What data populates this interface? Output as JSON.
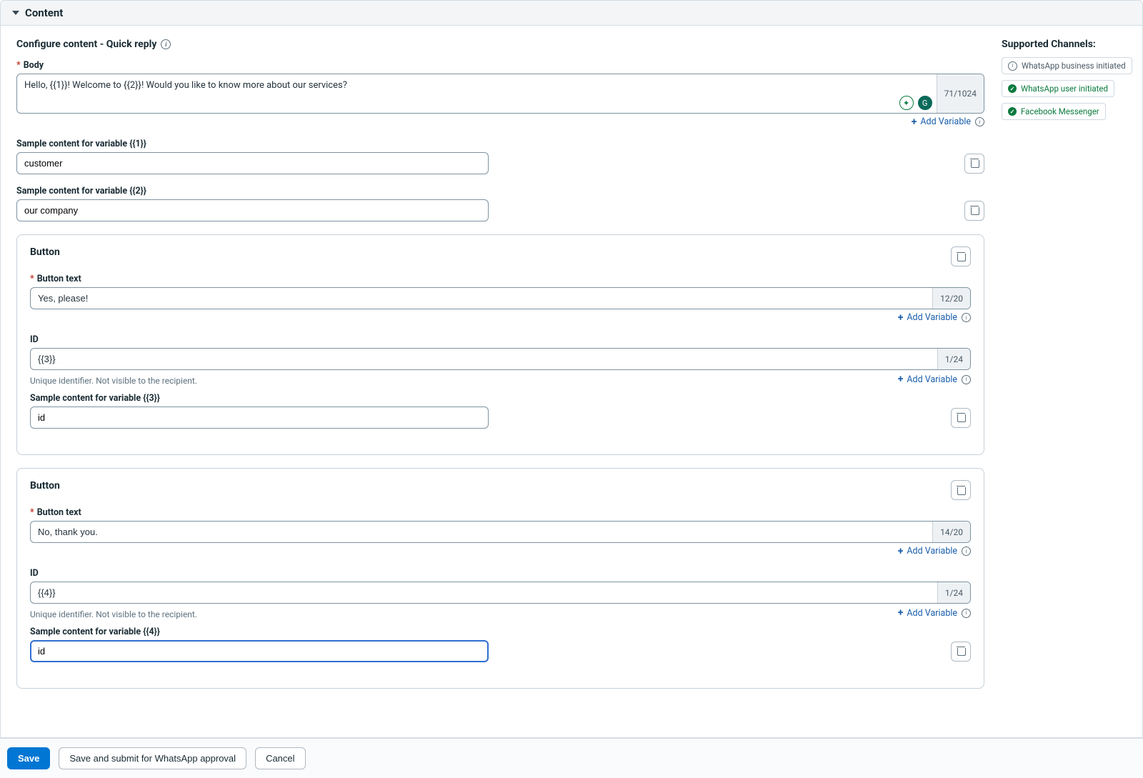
{
  "section": {
    "title": "Content"
  },
  "subheader": "Configure content - Quick reply",
  "body": {
    "label": "Body",
    "value": "Hello, {{1}}! Welcome to {{2}}! Would you like to know more about our services?",
    "counter": "71/1024",
    "addVariable": "Add Variable"
  },
  "vars": [
    {
      "label": "Sample content for variable {{1}}",
      "value": "customer"
    },
    {
      "label": "Sample content for variable {{2}}",
      "value": "our company"
    }
  ],
  "buttons": [
    {
      "title": "Button",
      "textLabel": "Button text",
      "textValue": "Yes, please!",
      "textCounter": "12/20",
      "addVariable": "Add Variable",
      "idLabel": "ID",
      "idValue": "{{3}}",
      "idCounter": "1/24",
      "idHint": "Unique identifier. Not visible to the recipient.",
      "sampleLabel": "Sample content for variable {{3}}",
      "sampleValue": "id",
      "sampleFocused": false
    },
    {
      "title": "Button",
      "textLabel": "Button text",
      "textValue": "No, thank you.",
      "textCounter": "14/20",
      "addVariable": "Add Variable",
      "idLabel": "ID",
      "idValue": "{{4}}",
      "idCounter": "1/24",
      "idHint": "Unique identifier. Not visible to the recipient.",
      "sampleLabel": "Sample content for variable {{4}}",
      "sampleValue": "id",
      "sampleFocused": true
    }
  ],
  "channels": {
    "title": "Supported Channels:",
    "items": [
      {
        "label": "WhatsApp business initiated",
        "status": "warn"
      },
      {
        "label": "WhatsApp user initiated",
        "status": "ok"
      },
      {
        "label": "Facebook Messenger",
        "status": "ok"
      }
    ]
  },
  "footer": {
    "save": "Save",
    "submit": "Save and submit for WhatsApp approval",
    "cancel": "Cancel"
  }
}
